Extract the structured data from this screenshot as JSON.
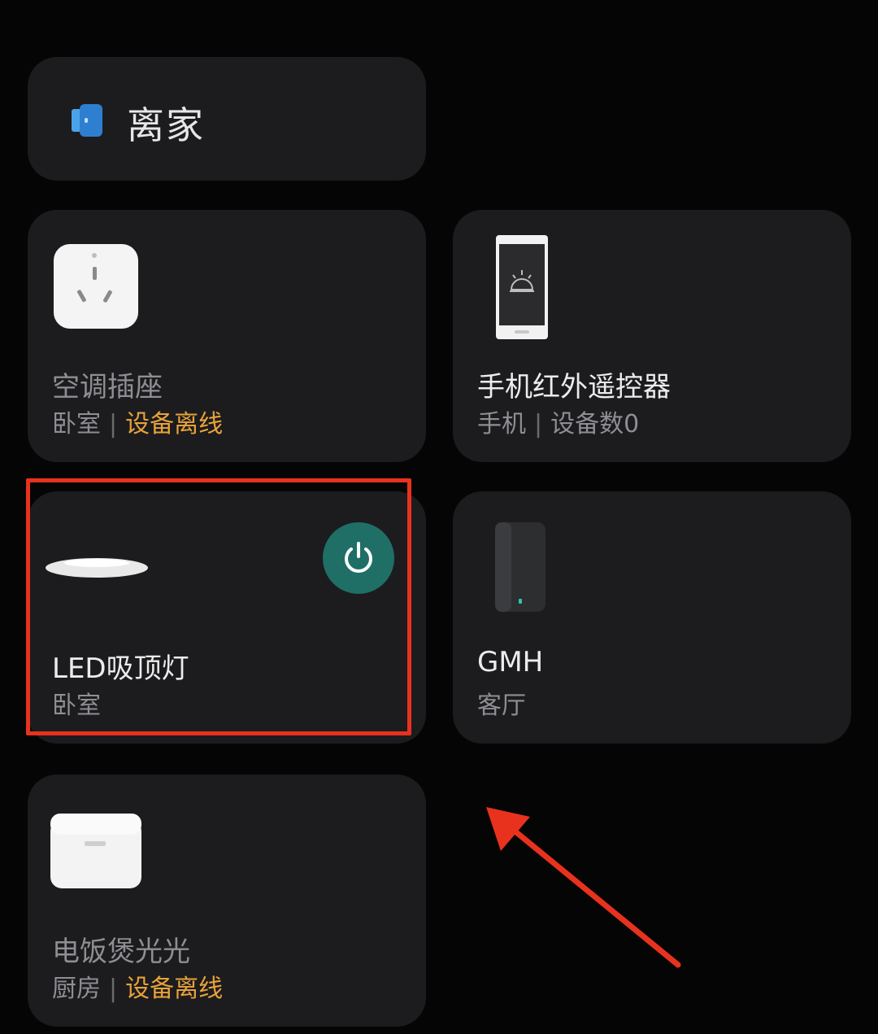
{
  "scene": {
    "label": "离家",
    "icon": "door-icon"
  },
  "devices": [
    {
      "id": "ac-plug",
      "name": "空调插座",
      "room": "卧室",
      "status": "设备离线",
      "icon": "smart-plug-icon"
    },
    {
      "id": "ir-remote",
      "name": "手机红外遥控器",
      "room": "手机",
      "status": "设备数0",
      "icon": "phone-remote-icon"
    },
    {
      "id": "led-light",
      "name": "LED吸顶灯",
      "room": "卧室",
      "icon": "ceiling-light-icon",
      "power_icon": "power-icon"
    },
    {
      "id": "gmh",
      "name": "GMH",
      "room": "客厅",
      "icon": "router-icon"
    },
    {
      "id": "rice-cooker",
      "name": "电饭煲光光",
      "room": "厨房",
      "status": "设备离线",
      "icon": "rice-cooker-icon"
    }
  ],
  "colors": {
    "background": "#050505",
    "card": "#1c1c1e",
    "offline": "#e8a23a",
    "power_button": "#1f6f66",
    "annotation": "#e8321e"
  }
}
